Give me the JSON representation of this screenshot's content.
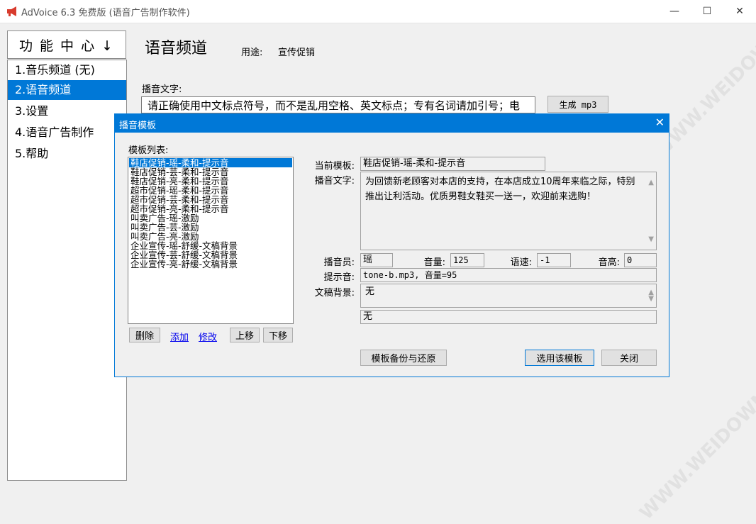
{
  "window": {
    "title": "AdVoice 6.3 免费版  (语音广告制作软件)",
    "minimize_glyph": "—",
    "maximize_glyph": "☐",
    "close_glyph": "✕"
  },
  "sidebar": {
    "header": "功 能 中 心 ↓",
    "items": [
      {
        "label": "1.音乐频道 (无)"
      },
      {
        "label": "2.语音频道"
      },
      {
        "label": "3.设置"
      },
      {
        "label": "4.语音广告制作"
      },
      {
        "label": "5.帮助"
      }
    ]
  },
  "main": {
    "title": "语音频道",
    "usage_label": "用途:",
    "usage_value": "宣传促销",
    "broadcast_label": "播音文字:",
    "broadcast_text": "请正确使用中文标点符号，而不是乱用空格、英文标点；专有名词请加引号；电",
    "generate_button": "生成 mp3"
  },
  "dialog": {
    "title": "播音模板",
    "close_glyph": "✕",
    "list_label": "模板列表:",
    "templates": [
      "鞋店促销-瑶-柔和-提示音",
      "鞋店促销-芸-柔和-提示音",
      "鞋店促销-亮-柔和-提示音",
      "超市促销-瑶-柔和-提示音",
      "超市促销-芸-柔和-提示音",
      "超市促销-亮-柔和-提示音",
      "叫卖广告-瑶-激励",
      "叫卖广告-芸-激励",
      "叫卖广告-亮-激励",
      "企业宣传-瑶-舒缓-文稿背景",
      "企业宣传-芸-舒缓-文稿背景",
      "企业宣传-亮-舒缓-文稿背景"
    ],
    "buttons": {
      "delete": "删除",
      "add": "添加",
      "edit": "修改",
      "move_up": "上移",
      "move_down": "下移",
      "backup": "模板备份与还原",
      "use": "选用该模板",
      "close": "关闭"
    },
    "fields": {
      "current_label": "当前模板:",
      "current_value": "鞋店促销-瑶-柔和-提示音",
      "text_label": "播音文字:",
      "text_value": "为回馈新老顾客对本店的支持，在本店成立10周年来临之际，特别推出让利活动。优质男鞋女鞋买一送一，欢迎前来选购！",
      "announcer_label": "播音员:",
      "announcer_value": "瑶",
      "volume_label": "音量:",
      "volume_value": "125",
      "speed_label": "语速:",
      "speed_value": "-1",
      "pitch_label": "音高:",
      "pitch_value": "0",
      "prompt_label": "提示音:",
      "prompt_value": "tone-b.mp3, 音量=95",
      "bg_label": "文稿背景:",
      "bg_value": "无",
      "bg_value2": "无"
    }
  },
  "watermark": "WWW.WEIDOWN.COM",
  "colors": {
    "accent": "#0078d7",
    "app_icon": "#d83b2d"
  }
}
